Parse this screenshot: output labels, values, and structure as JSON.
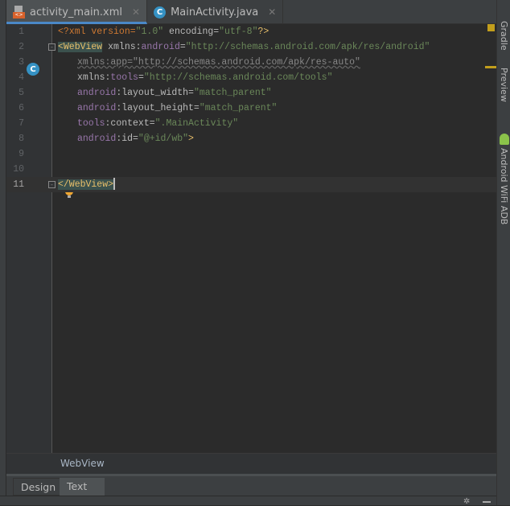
{
  "tabs": [
    {
      "label": "activity_main.xml",
      "icon": "xml-file-icon",
      "active": true
    },
    {
      "label": "MainActivity.java",
      "icon": "class-c-icon",
      "active": false
    }
  ],
  "editor": {
    "line_numbers": [
      "1",
      "2",
      "3",
      "4",
      "5",
      "6",
      "7",
      "8",
      "9",
      "10",
      "11"
    ],
    "lines": {
      "l1": {
        "a": "<?xml version=",
        "b": "\"1.0\"",
        "c": " encoding=",
        "d": "\"utf-8\"",
        "e": "?>"
      },
      "l2": {
        "tag": "<WebView",
        "attr": " xmlns:",
        "ns": "android",
        "eq": "=",
        "val": "\"http://schemas.android.com/apk/res/android\""
      },
      "l3": {
        "attr": "xmlns:app=",
        "val": "\"http://schemas.android.com/apk/res-auto\""
      },
      "l4": {
        "attr": "xmlns:",
        "ns": "tools",
        "eq": "=",
        "val": "\"http://schemas.android.com/tools\""
      },
      "l5": {
        "ns": "android",
        "attr": ":layout_width=",
        "val": "\"match_parent\""
      },
      "l6": {
        "ns": "android",
        "attr": ":layout_height=",
        "val": "\"match_parent\""
      },
      "l7": {
        "ns": "tools",
        "attr": ":context=",
        "val": "\".MainActivity\""
      },
      "l8": {
        "ns": "android",
        "attr": ":id=",
        "val": "\"@+id/wb\"",
        "end": ">"
      },
      "l11": {
        "tag": "</WebView>"
      }
    }
  },
  "side_panels": [
    "Gradle",
    "Preview",
    "Android WiFi ADB"
  ],
  "breadcrumb": "WebView",
  "bottom_tabs": [
    {
      "label": "Design",
      "selected": false
    },
    {
      "label": "Text",
      "selected": true
    }
  ],
  "colors": {
    "accent": "#4a88c7",
    "tag": "#e8bf6a",
    "string": "#6a8759",
    "namespace": "#9876aa",
    "xml_icon": "#d9622b",
    "class_icon": "#3592c4",
    "warning": "#c29e1c"
  }
}
